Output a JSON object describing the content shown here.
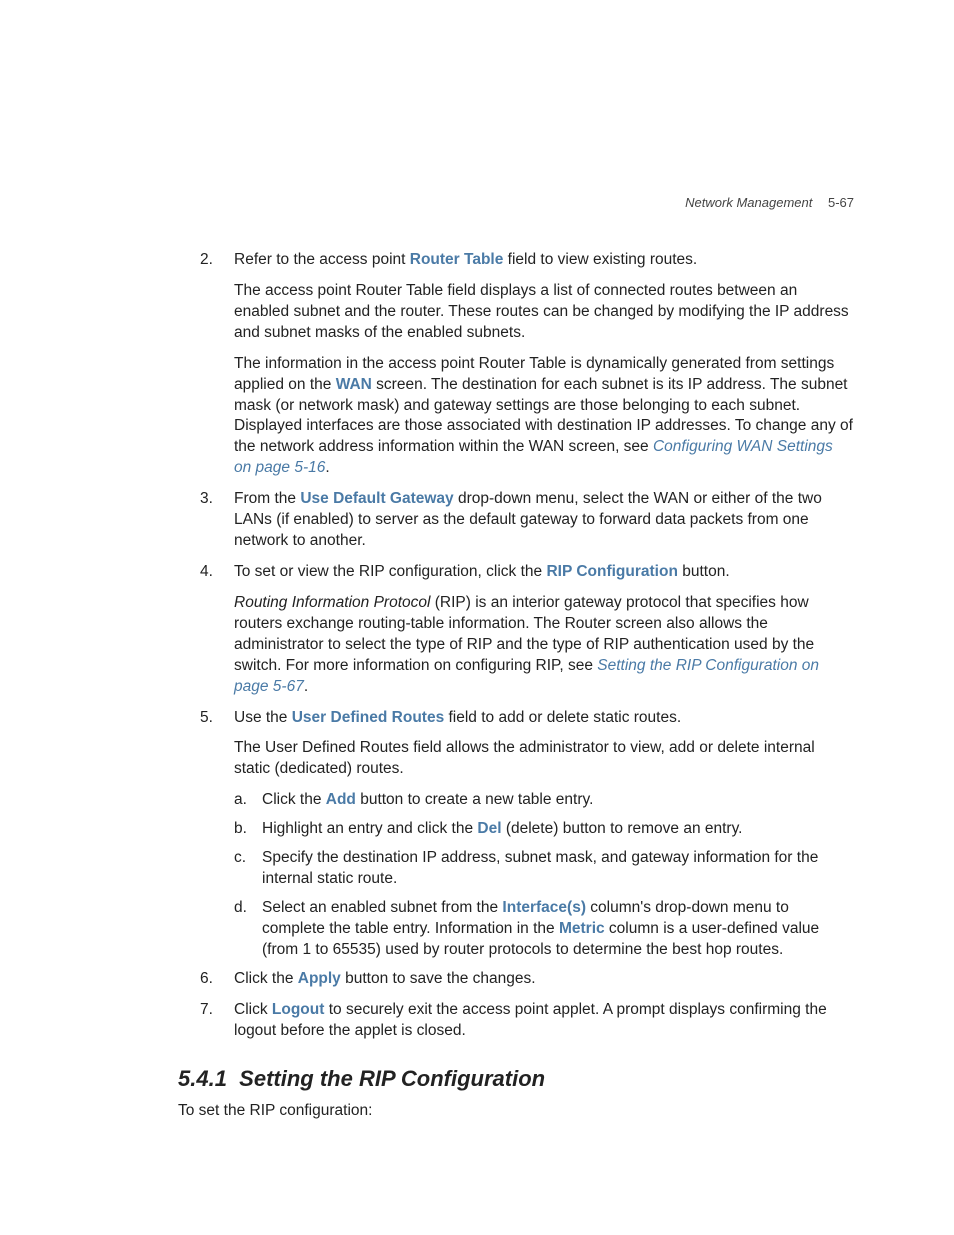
{
  "header": {
    "chapter": "Network Management",
    "pagenum": "5-67"
  },
  "items": [
    {
      "num": "2.",
      "paras": [
        [
          {
            "t": "Refer to the access point "
          },
          {
            "t": "Router Table",
            "cls": "bold-blue"
          },
          {
            "t": " field to view existing routes."
          }
        ],
        [
          {
            "t": "The access point Router Table field displays a list of connected routes between an enabled subnet and the router. These routes can be changed by modifying the IP address and subnet masks of the enabled subnets."
          }
        ],
        [
          {
            "t": "The information in the access point Router Table is dynamically generated from settings applied on the "
          },
          {
            "t": "WAN",
            "cls": "bold-blue"
          },
          {
            "t": " screen. The destination for each subnet is its IP address. The subnet mask (or network mask) and gateway settings are those belonging to each subnet. Displayed interfaces are those associated with destination IP addresses. To change any of the network address information within the WAN screen, see "
          },
          {
            "t": "Configuring WAN Settings on page 5-16",
            "cls": "link-blue"
          },
          {
            "t": "."
          }
        ]
      ]
    },
    {
      "num": "3.",
      "paras": [
        [
          {
            "t": "From the "
          },
          {
            "t": "Use Default Gateway",
            "cls": "bold-blue"
          },
          {
            "t": " drop-down menu, select the WAN or either of the two LANs (if enabled) to server as the default gateway to forward data packets from one network to another."
          }
        ]
      ]
    },
    {
      "num": "4.",
      "paras": [
        [
          {
            "t": "To set or view the RIP configuration, click the "
          },
          {
            "t": "RIP Configuration",
            "cls": "bold-blue"
          },
          {
            "t": " button."
          }
        ],
        [
          {
            "t": "Routing Information Protocol",
            "cls": "italic"
          },
          {
            "t": " (RIP) is an interior gateway protocol that specifies how routers exchange routing-table information. The Router screen also allows the administrator to select the type of RIP and the type of RIP authentication used by the switch. For more information on configuring RIP, see "
          },
          {
            "t": "Setting the RIP Configuration on page 5-67",
            "cls": "link-blue"
          },
          {
            "t": "."
          }
        ]
      ]
    },
    {
      "num": "5.",
      "paras": [
        [
          {
            "t": "Use the "
          },
          {
            "t": "User Defined Routes",
            "cls": "bold-blue"
          },
          {
            "t": " field to add or delete static routes."
          }
        ],
        [
          {
            "t": "The User Defined Routes field allows the administrator to view, add or delete internal static (dedicated) routes."
          }
        ]
      ],
      "sub": [
        {
          "lett": "a.",
          "runs": [
            {
              "t": "Click the "
            },
            {
              "t": "Add",
              "cls": "bold-blue"
            },
            {
              "t": " button to create a new table entry."
            }
          ]
        },
        {
          "lett": "b.",
          "runs": [
            {
              "t": "Highlight an entry and click the "
            },
            {
              "t": "Del",
              "cls": "bold-blue"
            },
            {
              "t": " (delete) button to remove an entry."
            }
          ]
        },
        {
          "lett": "c.",
          "runs": [
            {
              "t": "Specify the destination IP address, subnet mask, and gateway information for the internal static route."
            }
          ]
        },
        {
          "lett": "d.",
          "runs": [
            {
              "t": "Select an enabled subnet from the "
            },
            {
              "t": "Interface(s)",
              "cls": "bold-blue"
            },
            {
              "t": " column's drop-down menu to complete the table entry. Information in the "
            },
            {
              "t": "Metric",
              "cls": "bold-blue"
            },
            {
              "t": " column is a user-defined value (from 1 to 65535) used by router protocols to determine the best hop routes."
            }
          ]
        }
      ]
    },
    {
      "num": "6.",
      "paras": [
        [
          {
            "t": "Click the "
          },
          {
            "t": "Apply",
            "cls": "bold-blue"
          },
          {
            "t": " button to save the changes."
          }
        ]
      ]
    },
    {
      "num": "7.",
      "paras": [
        [
          {
            "t": "Click "
          },
          {
            "t": "Logout",
            "cls": "bold-blue"
          },
          {
            "t": " to securely exit the access point applet. A prompt displays confirming the logout before the applet is closed."
          }
        ]
      ]
    }
  ],
  "section": {
    "number": "5.4.1",
    "title": "Setting the RIP Configuration",
    "intro": "To set the RIP configuration:"
  }
}
